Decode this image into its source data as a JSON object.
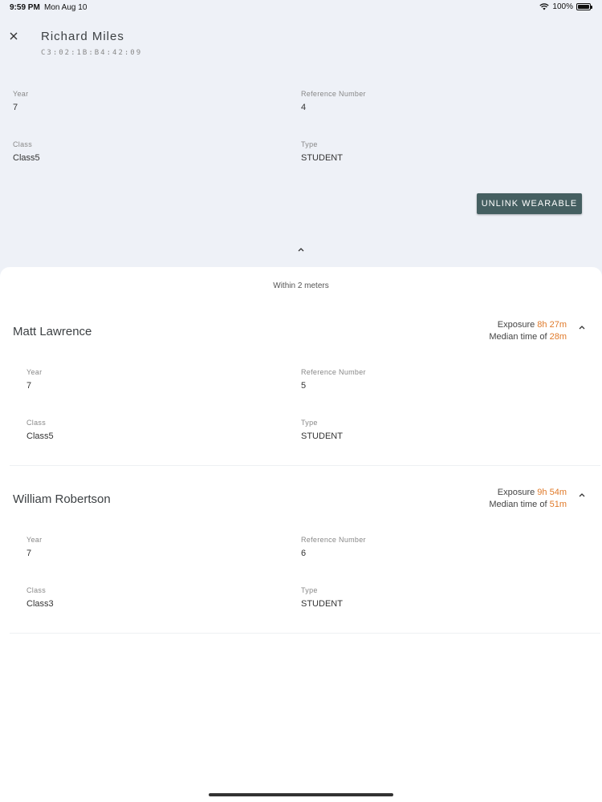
{
  "status_bar": {
    "time": "9:59 PM",
    "date": "Mon Aug 10",
    "battery": "100%"
  },
  "header": {
    "title": "Richard Miles",
    "subtitle": "C3:02:1B:B4:42:09"
  },
  "device": {
    "year_label": "Year",
    "year": "7",
    "ref_label": "Reference Number",
    "ref": "4",
    "class_label": "Class",
    "class": "Class5",
    "type_label": "Type",
    "type": "STUDENT"
  },
  "unlink_label": "UNLINK WEARABLE",
  "sheet": {
    "title": "Within 2 meters",
    "contacts": [
      {
        "name": "Matt Lawrence",
        "exposure_label": "Exposure",
        "exposure": "8h 27m",
        "median_label": "Median time of",
        "median": "28m",
        "year_label": "Year",
        "year": "7",
        "ref_label": "Reference Number",
        "ref": "5",
        "class_label": "Class",
        "class": "Class5",
        "type_label": "Type",
        "type": "STUDENT"
      },
      {
        "name": "William Robertson",
        "exposure_label": "Exposure",
        "exposure": "9h 54m",
        "median_label": "Median time of",
        "median": "51m",
        "year_label": "Year",
        "year": "7",
        "ref_label": "Reference Number",
        "ref": "6",
        "class_label": "Class",
        "class": "Class3",
        "type_label": "Type",
        "type": "STUDENT"
      }
    ]
  },
  "icons": {
    "close": "close-icon",
    "collapse": "chevron-up-icon",
    "wifi": "wifi-icon",
    "battery": "battery-icon",
    "contact_chevron": "chevron-up-icon"
  },
  "colors": {
    "accent": "#455f61",
    "highlight": "#e07a2a",
    "header_bg": "#eef1f7"
  }
}
